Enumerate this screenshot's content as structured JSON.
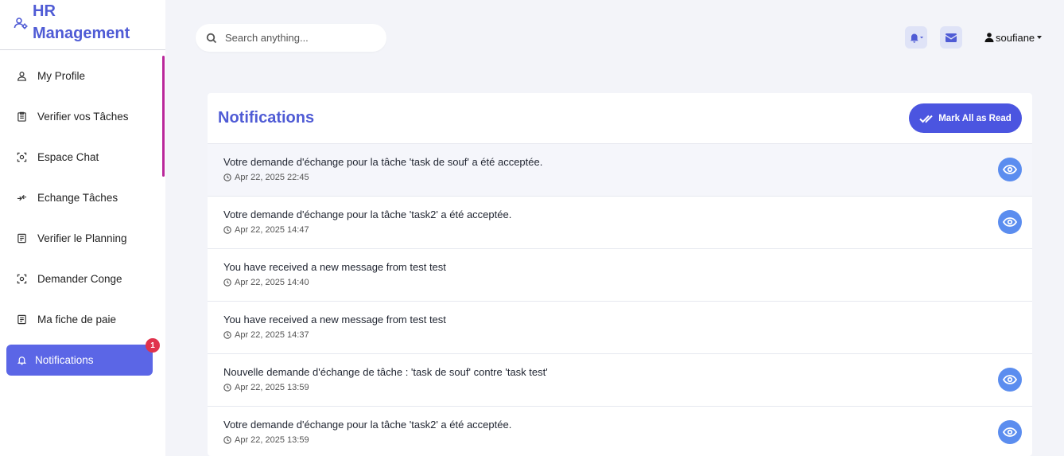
{
  "brand": {
    "title_line1": "HR",
    "title_line2": "Management",
    "icon": "users-cog-icon"
  },
  "sidebar": {
    "items": [
      {
        "label": "My Profile",
        "icon": "user-icon"
      },
      {
        "label": "Verifier vos Tâches",
        "icon": "clipboard-icon"
      },
      {
        "label": "Espace Chat",
        "icon": "chat-icon"
      },
      {
        "label": "Echange Tâches",
        "icon": "exchange-icon"
      },
      {
        "label": "Verifier le Planning",
        "icon": "calendar-icon"
      },
      {
        "label": "Demander Conge",
        "icon": "leave-icon"
      },
      {
        "label": "Ma fiche de paie",
        "icon": "payslip-icon"
      },
      {
        "label": "Notifications",
        "icon": "bell-icon",
        "active": true,
        "badge": "1"
      }
    ]
  },
  "topbar": {
    "search_placeholder": "Search anything...",
    "user_name": "soufiane",
    "accent": "#4f5bd5"
  },
  "main": {
    "title": "Notifications",
    "mark_all_label": "Mark All as Read",
    "notifications": [
      {
        "message": "Votre demande d'échange pour la tâche 'task de souf' a été acceptée.",
        "time": "Apr 22, 2025 22:45",
        "has_view": true
      },
      {
        "message": "Votre demande d'échange pour la tâche 'task2' a été acceptée.",
        "time": "Apr 22, 2025 14:47",
        "has_view": true
      },
      {
        "message": "You have received a new message from test test",
        "time": "Apr 22, 2025 14:40",
        "has_view": false
      },
      {
        "message": "You have received a new message from test test",
        "time": "Apr 22, 2025 14:37",
        "has_view": false
      },
      {
        "message": "Nouvelle demande d'échange de tâche : 'task de souf' contre 'task test'",
        "time": "Apr 22, 2025 13:59",
        "has_view": true
      },
      {
        "message": "Votre demande d'échange pour la tâche 'task2' a été acceptée.",
        "time": "Apr 22, 2025 13:59",
        "has_view": true
      }
    ]
  }
}
